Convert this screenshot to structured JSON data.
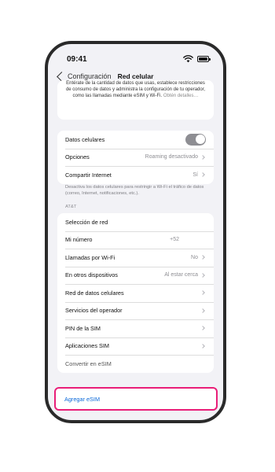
{
  "status_bar": {
    "time": "09:41"
  },
  "nav": {
    "back_label": "Configuración",
    "title": "Red celular"
  },
  "info": {
    "text": "Entérate de la cantidad de datos que usas, establece restricciones de consumo de datos y administra la configuración de tu operador, como las llamadas mediante eSIM y Wi-Fi.",
    "link": "Obtén detalles…"
  },
  "data_group": {
    "cellular_data_label": "Datos celulares",
    "cellular_data_on": true,
    "options_label": "Opciones",
    "options_value": "Roaming desactivado",
    "hotspot_label": "Compartir Internet",
    "hotspot_value": "Sí"
  },
  "footnote": "Desactiva los datos celulares para restringir a Wi-Fi el tráfico de datos (correo, Internet, notificaciones, etc.).",
  "carrier_header": "AT&T",
  "carrier_rows": [
    {
      "label": "Selección de red",
      "value": ""
    },
    {
      "label": "Mi número",
      "value": "+52"
    },
    {
      "label": "Llamadas por Wi-Fi",
      "value": "No"
    },
    {
      "label": "En otros dispositivos",
      "value": "Al estar cerca"
    },
    {
      "label": "Red de datos celulares",
      "value": ""
    },
    {
      "label": "Servicios del operador",
      "value": ""
    },
    {
      "label": "PIN de la SIM",
      "value": ""
    },
    {
      "label": "Aplicaciones SIM",
      "value": ""
    },
    {
      "label": "Convertir en eSIM",
      "value": ""
    }
  ],
  "add_esim_label": "Agregar eSIM",
  "colors": {
    "highlight": "#e91e78",
    "link": "#0a68d9",
    "toggle": "#8e8e93"
  }
}
